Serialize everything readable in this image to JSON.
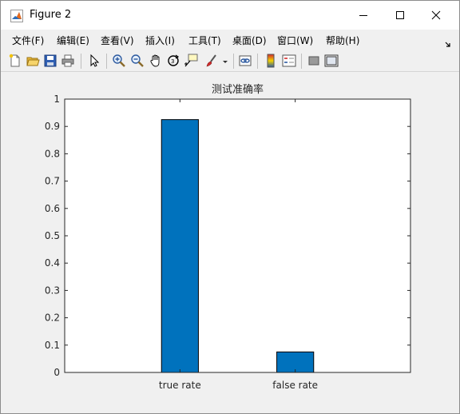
{
  "window": {
    "title": "Figure 2"
  },
  "menu": {
    "items": [
      {
        "label": "文件(F)"
      },
      {
        "label": "编辑(E)"
      },
      {
        "label": "查看(V)"
      },
      {
        "label": "插入(I)"
      },
      {
        "label": "工具(T)"
      },
      {
        "label": "桌面(D)"
      },
      {
        "label": "窗口(W)"
      },
      {
        "label": "帮助(H)"
      }
    ]
  },
  "toolbar": {
    "icons": [
      "new-figure-icon",
      "open-file-icon",
      "save-icon",
      "print-icon",
      "select-arrow-icon",
      "zoom-in-icon",
      "zoom-out-icon",
      "pan-hand-icon",
      "rotate-3d-icon",
      "data-cursor-icon",
      "brush-icon",
      "dropdown-arrow-icon",
      "link-plot-icon",
      "colorbar-icon",
      "legend-icon",
      "hide-plot-tools-icon",
      "show-plot-tools-icon"
    ]
  },
  "colors": {
    "bar": "#0072bd",
    "axes_background": "#ffffff",
    "figure_background": "#f0f0f0"
  },
  "chart_data": {
    "type": "bar",
    "title": "测试准确率",
    "categories": [
      "true rate",
      "false rate"
    ],
    "values": [
      0.925,
      0.075
    ],
    "ylim": [
      0,
      1
    ],
    "yticks": [
      "0",
      "0.1",
      "0.2",
      "0.3",
      "0.4",
      "0.5",
      "0.6",
      "0.7",
      "0.8",
      "0.9",
      "1"
    ],
    "xlabel": "",
    "ylabel": "",
    "grid": false
  }
}
